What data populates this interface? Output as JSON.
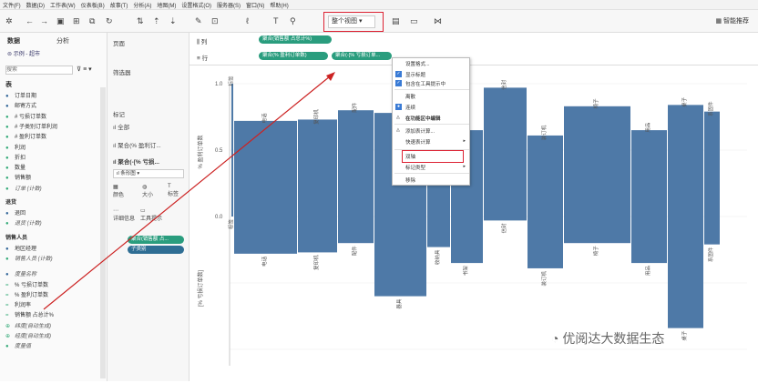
{
  "menu": [
    "文件(F)",
    "数据(D)",
    "工作表(W)",
    "仪表板(B)",
    "故事(T)",
    "分析(A)",
    "地图(M)",
    "设置格式(O)",
    "服务器(S)",
    "窗口(N)",
    "帮助(H)"
  ],
  "toolbar": {
    "view_label": "整个视图",
    "smart_label": "智能推荐"
  },
  "left": {
    "tab_data": "数据",
    "tab_analysis": "分析",
    "datasource": "示例 - 超市",
    "search_placeholder": "搜索",
    "section_table": "表",
    "fields": [
      {
        "label": "订单日期",
        "kind": "dim"
      },
      {
        "label": "邮寄方式",
        "kind": "dim"
      },
      {
        "label": "# 亏损订单数",
        "kind": "meas"
      },
      {
        "label": "# 子类别订单利润",
        "kind": "meas"
      },
      {
        "label": "# 盈利订单数",
        "kind": "meas"
      },
      {
        "label": "利润",
        "kind": "meas"
      },
      {
        "label": "折扣",
        "kind": "meas"
      },
      {
        "label": "数量",
        "kind": "meas"
      },
      {
        "label": "销售额",
        "kind": "meas"
      },
      {
        "label": "订单 (计数)",
        "kind": "meas",
        "italic": true
      }
    ],
    "returns_header": "退货",
    "returns_fields": [
      {
        "label": "退回",
        "kind": "dim"
      },
      {
        "label": "退货 (计数)",
        "kind": "meas",
        "italic": true
      }
    ],
    "sales_header": "销售人员",
    "sales_fields": [
      {
        "label": "地区经理",
        "kind": "dim"
      },
      {
        "label": "销售人员 (计数)",
        "kind": "meas",
        "italic": true
      }
    ],
    "extra_fields": [
      {
        "label": "度量名称",
        "kind": "dim",
        "italic": true
      },
      {
        "label": "% 亏损订单数",
        "kind": "calc"
      },
      {
        "label": "% 盈利订单数",
        "kind": "calc"
      },
      {
        "label": "利润率",
        "kind": "calc"
      },
      {
        "label": "销售额 占总计%",
        "kind": "calc"
      },
      {
        "label": "纬度(自动生成)",
        "kind": "geo",
        "italic": true
      },
      {
        "label": "经度(自动生成)",
        "kind": "geo",
        "italic": true
      },
      {
        "label": "度量值",
        "kind": "meas",
        "italic": true
      }
    ]
  },
  "mid": {
    "pages": "页面",
    "filters": "筛选器",
    "marks": "标记",
    "marks_all": "全部",
    "marks_1": "聚合(% 盈利订...",
    "marks_2": "聚合(-[% 亏损...",
    "mark_type": "条形图",
    "btn_color": "颜色",
    "btn_size": "大小",
    "btn_label": "标签",
    "btn_detail": "详细信息",
    "btn_tooltip": "工具提示",
    "pill_1": "聚合(销售额 占...",
    "pill_2": "子类别"
  },
  "shelf": {
    "columns": "列",
    "rows": "行",
    "col_pill": "聚合(销售额 占总计%)",
    "row_pill_1": "聚合(% 盈利订单数)",
    "row_pill_2": "聚合(-[% 亏损订单..."
  },
  "context_menu": {
    "items": [
      "设置格式...",
      "显示标题",
      "包含在工具提示中",
      "离散",
      "连续",
      "在功能区中编辑",
      "添加表计算...",
      "快速表计算",
      "双轴",
      "标记类型",
      "移除"
    ]
  },
  "axis": {
    "upper_title": "% 盈利订单数",
    "lower_title": "[% 亏损订单数]",
    "tick_top": "1.0",
    "tick_mid": "0.5",
    "tick_zero": "0.0"
  },
  "chart_data": {
    "type": "bar",
    "categories": [
      "标签",
      "电话",
      "复印机",
      "配件",
      "器具",
      "收纳具",
      "书架",
      "信封",
      "装订机",
      "椅子",
      "用品",
      "桌子",
      "系固件"
    ],
    "series": [
      {
        "name": "% 盈利订单数",
        "values": [
          1.0,
          0.72,
          0.73,
          0.8,
          0.78,
          0.77,
          0.65,
          0.97,
          0.61,
          0.83,
          0.65,
          0.84,
          0.79
        ]
      },
      {
        "name": "-[% 亏损订单数]",
        "values": [
          0.0,
          -0.28,
          -0.27,
          -0.2,
          -0.6,
          -0.23,
          -0.35,
          -0.03,
          -0.39,
          -0.2,
          -0.35,
          -0.84,
          -0.21
        ]
      }
    ],
    "ylim": [
      -1.0,
      1.0
    ]
  },
  "watermark": "优阅达大数据生态"
}
